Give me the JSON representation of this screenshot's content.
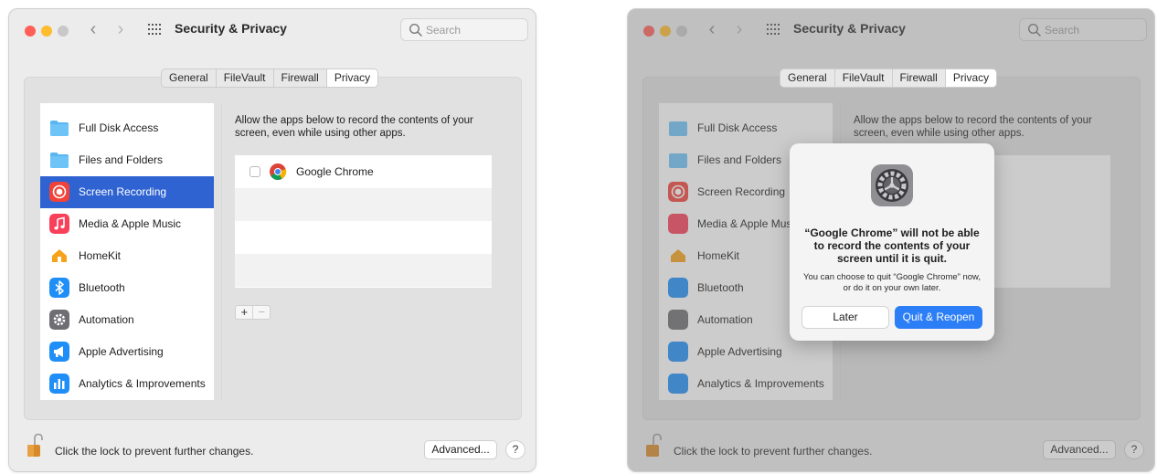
{
  "colors": {
    "traffic_red": "#ff5f57",
    "traffic_yellow": "#febc2e",
    "traffic_green": "#c8c8c8",
    "selection_blue": "#2f63d1",
    "primary_button": "#2b7ef6",
    "folder_blue": "#5ab6f2"
  },
  "left_window": {
    "title": "Security & Privacy",
    "search_placeholder": "Search",
    "tabs": [
      {
        "label": "General"
      },
      {
        "label": "FileVault"
      },
      {
        "label": "Firewall"
      },
      {
        "label": "Privacy",
        "active": true
      }
    ],
    "sidebar": [
      {
        "label": "Full Disk Access",
        "icon": "folder-icon"
      },
      {
        "label": "Files and Folders",
        "icon": "folder-icon"
      },
      {
        "label": "Screen Recording",
        "icon": "screen-recording-icon",
        "selected": true
      },
      {
        "label": "Media & Apple Music",
        "icon": "music-icon"
      },
      {
        "label": "HomeKit",
        "icon": "home-icon"
      },
      {
        "label": "Bluetooth",
        "icon": "bluetooth-icon"
      },
      {
        "label": "Automation",
        "icon": "gear-icon"
      },
      {
        "label": "Apple Advertising",
        "icon": "megaphone-icon"
      },
      {
        "label": "Analytics & Improvements",
        "icon": "chart-icon"
      }
    ],
    "description": "Allow the apps below to record the contents of your screen, even while using other apps.",
    "apps": [
      {
        "name": "Google Chrome",
        "checked": false,
        "icon": "chrome-icon"
      }
    ],
    "plus": "+",
    "minus": "−",
    "lock_text": "Click the lock to prevent further changes.",
    "advanced_label": "Advanced...",
    "help_label": "?"
  },
  "right_window": {
    "title": "Security & Privacy",
    "search_placeholder": "Search",
    "tabs": [
      {
        "label": "General"
      },
      {
        "label": "FileVault"
      },
      {
        "label": "Firewall"
      },
      {
        "label": "Privacy",
        "active": true
      }
    ],
    "sidebar": [
      {
        "label": "Full Disk Access"
      },
      {
        "label": "Files and Folders"
      },
      {
        "label": "Screen Recording"
      },
      {
        "label": "Media & Apple Mus"
      },
      {
        "label": "HomeKit"
      },
      {
        "label": "Bluetooth"
      },
      {
        "label": "Automation"
      },
      {
        "label": "Apple Advertising"
      },
      {
        "label": "Analytics & Improvements"
      }
    ],
    "description": "Allow the apps below to record the contents of your screen, even while using other apps.",
    "lock_text": "Click the lock to prevent further changes.",
    "advanced_label": "Advanced...",
    "help_label": "?"
  },
  "alert": {
    "icon": "system-preferences-icon",
    "title": "“Google Chrome” will not be able to record the contents of your screen until it is quit.",
    "message": "You can choose to quit “Google Chrome” now, or do it on your own later.",
    "later_label": "Later",
    "quit_label": "Quit & Reopen"
  }
}
